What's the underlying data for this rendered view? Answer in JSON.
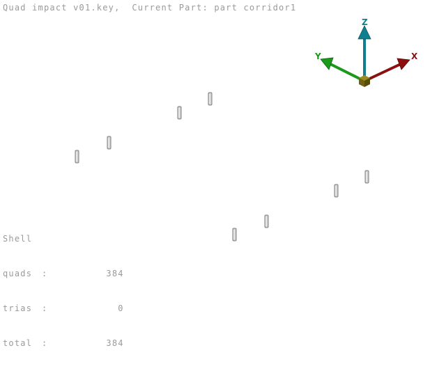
{
  "header": {
    "file": "Quad impact v01.key,",
    "part_label": "Current Part:",
    "part_name": "part corridor1"
  },
  "stats": {
    "title": "Shell",
    "rows": [
      {
        "label": "quads",
        "sep": ":",
        "value": "384"
      },
      {
        "label": "trias",
        "sep": ":",
        "value": "0"
      },
      {
        "label": "total",
        "sep": ":",
        "value": "384"
      }
    ]
  },
  "triad": {
    "labels": {
      "x": "X",
      "y": "Y",
      "z": "Z"
    },
    "colors": {
      "x": "#8b1010",
      "y": "#1a9a1a",
      "z": "#0f7f8f",
      "origin": "#7a6a12"
    }
  },
  "parts": {
    "name": "shell-element",
    "count": 8,
    "color": "#c8c8c8"
  }
}
